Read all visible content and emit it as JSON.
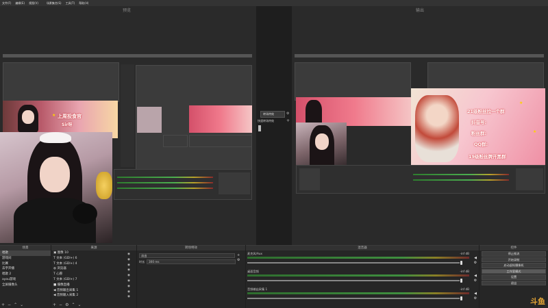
{
  "menu": [
    "文件(F)",
    "编辑(E)",
    "视图(V)",
    "",
    "场景集合(S)",
    "工具(T)",
    "帮助(H)"
  ],
  "panes": {
    "preview_title": "预览",
    "program_title": "输出"
  },
  "overlays": {
    "left_banner_text": "上周投食官",
    "left_banner_sub": "Sir呀",
    "right_banner_lines": [
      "21级粉丝拉一个群",
      "抖音号:",
      "粉丝群:",
      "QQ群:",
      "19级粉丝牌开黑群"
    ]
  },
  "transition": {
    "button_label": "转场特效",
    "quick_label": "快速转场特效"
  },
  "docks": {
    "scenes": {
      "title": "场景",
      "items": [
        "唱歌",
        "游戏间",
        "比赛",
        "去字开播",
        "唱歌 2",
        "ayou游戏",
        "全屏摄像头"
      ],
      "selected_index": 0
    },
    "sources": {
      "title": "来源",
      "items": [
        "图像 10",
        "文本 (GDI+) 6",
        "文本 (GDI+) 4",
        "浏览器",
        "心愿",
        "文本 (GDI+) 7",
        "摄像直播",
        "音频输出采集 1",
        "音频输入采集 2"
      ]
    },
    "transitions": {
      "title": "转场特效",
      "select_value": "淡出",
      "duration_label": "时长",
      "duration_value": "300 ms"
    },
    "mixer": {
      "title": "混音器",
      "channels": [
        {
          "name": "麦克风/Aux",
          "db": "-inf dB"
        },
        {
          "name": "桌面音频",
          "db": "-inf dB"
        },
        {
          "name": "音频输出采集 1",
          "db": "-inf dB"
        }
      ]
    },
    "controls": {
      "title": "控件",
      "buttons": [
        "停止推流",
        "开始录制",
        "启动虚拟摄像机",
        "工作室模式",
        "设置",
        "退出"
      ],
      "active_index": 3
    }
  },
  "watermark": "斗鱼",
  "colors": {
    "background": "#1e1e1e",
    "dock": "#262626",
    "meter_green": "#4caf50",
    "meter_yellow": "#b8a32a",
    "watermark": "#e8a735"
  }
}
